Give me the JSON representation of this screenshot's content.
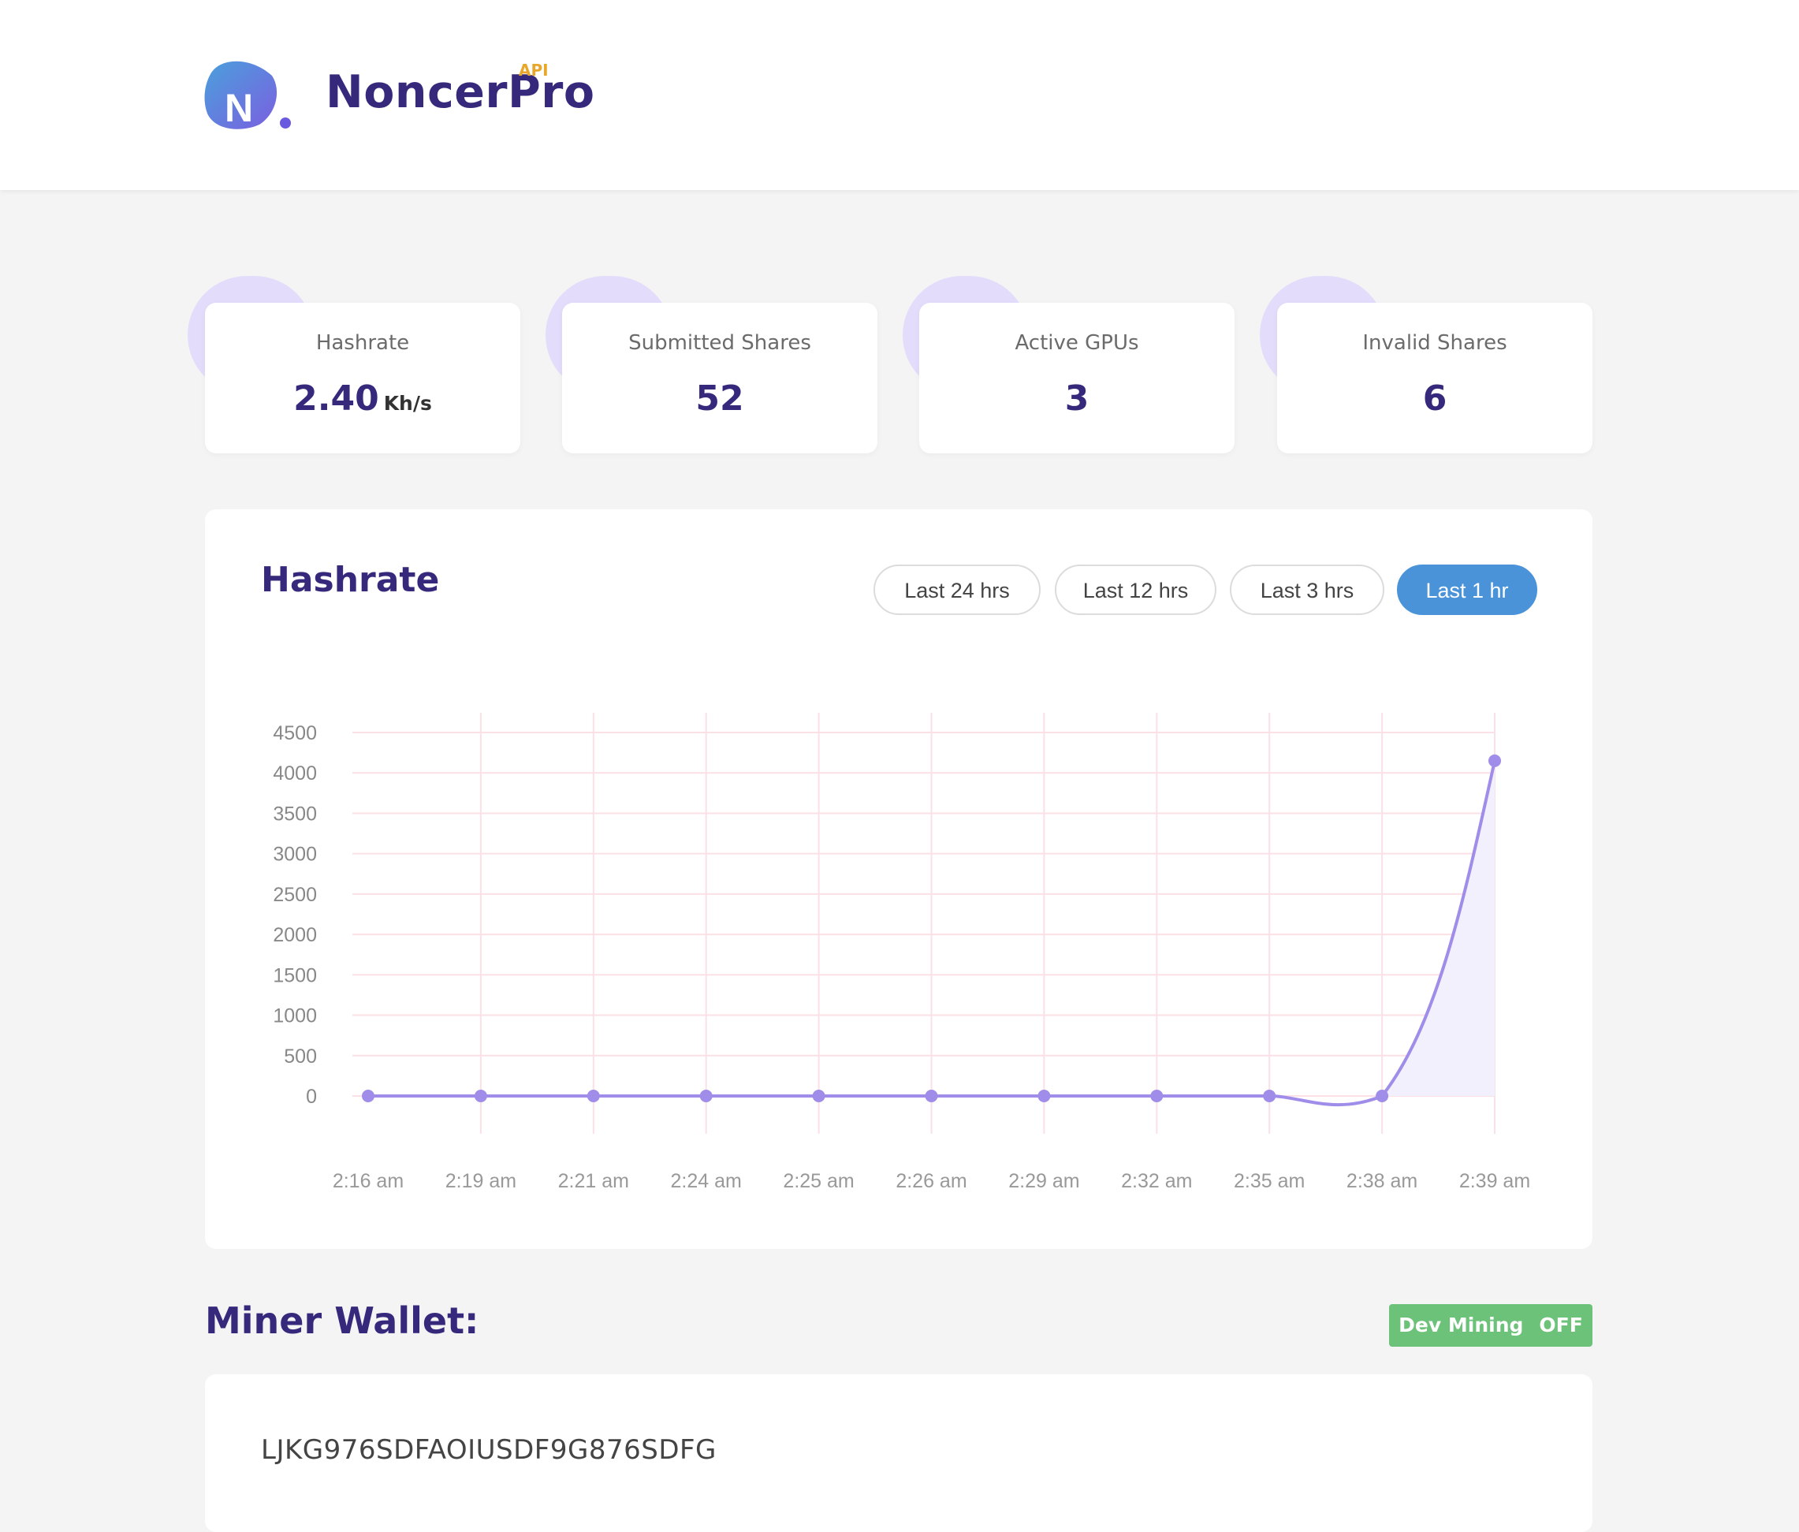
{
  "header": {
    "brand": "NoncerPro",
    "brand_sup": "API",
    "logo_icon": "noncerpro-logo-icon"
  },
  "stats": [
    {
      "label": "Hashrate",
      "value": "2.40",
      "unit": "Kh/s"
    },
    {
      "label": "Submitted Shares",
      "value": "52"
    },
    {
      "label": "Active GPUs",
      "value": "3"
    },
    {
      "label": "Invalid Shares",
      "value": "6"
    }
  ],
  "chart_card": {
    "title": "Hashrate",
    "ranges": [
      "Last 24 hrs",
      "Last 12 hrs",
      "Last 3 hrs",
      "Last 1 hr"
    ],
    "active_range": "Last 1 hr"
  },
  "chart_data": {
    "type": "line",
    "title": "",
    "xlabel": "",
    "ylabel": "",
    "categories": [
      "2:16 am",
      "2:19 am",
      "2:21 am",
      "2:24 am",
      "2:25 am",
      "2:26 am",
      "2:29 am",
      "2:32 am",
      "2:35 am",
      "2:38 am",
      "2:39 am"
    ],
    "series": [
      {
        "values": [
          0,
          0,
          0,
          0,
          0,
          0,
          0,
          0,
          0,
          0,
          4150
        ]
      }
    ],
    "ylim": [
      0,
      4500
    ],
    "yticks": [
      0,
      500,
      1000,
      1500,
      2000,
      2500,
      3000,
      3500,
      4000,
      4500
    ],
    "grid": true,
    "line_color": "#a08ce9",
    "fill_color": "#f3f0fd",
    "grid_color": "#fbe0e6"
  },
  "wallet": {
    "title": "Miner Wallet:",
    "dev_mining_label": "Dev Mining",
    "dev_mining_state": "OFF",
    "address": "LJKG976SDFAOIUSDF9G876SDFG"
  },
  "colors": {
    "brand": "#36297c",
    "accent": "#e9a72a",
    "active_button": "#4a93d9",
    "badge_green": "#6dc27a"
  }
}
